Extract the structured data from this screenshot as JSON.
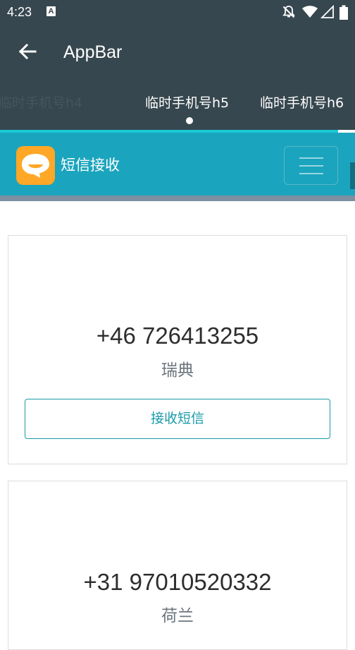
{
  "status_bar": {
    "time": "4:23",
    "a_badge": "A",
    "icons": [
      "a-notification-icon",
      "bell-off-icon",
      "wifi-icon",
      "signal-icon",
      "battery-icon"
    ]
  },
  "app_bar": {
    "title": "AppBar",
    "back_icon": "arrow-left-icon",
    "tabs": [
      {
        "label": "临时手机号h4"
      },
      {
        "label": "临时手机号h5",
        "selected": true
      },
      {
        "label": "临时手机号h6"
      }
    ]
  },
  "site": {
    "title": "短信接收",
    "logo_icon": "chat-bubble-logo-icon",
    "menu_icon": "hamburger-menu-icon"
  },
  "cards": [
    {
      "number": "+46 726413255",
      "country": "瑞典",
      "button_label": "接收短信"
    },
    {
      "number": "+31 97010520332",
      "country": "荷兰"
    }
  ],
  "colors": {
    "app_bar": "#37474f",
    "site_header": "#1ba4bd",
    "accent": "#1a9aa8",
    "logo": "#ffa726"
  }
}
